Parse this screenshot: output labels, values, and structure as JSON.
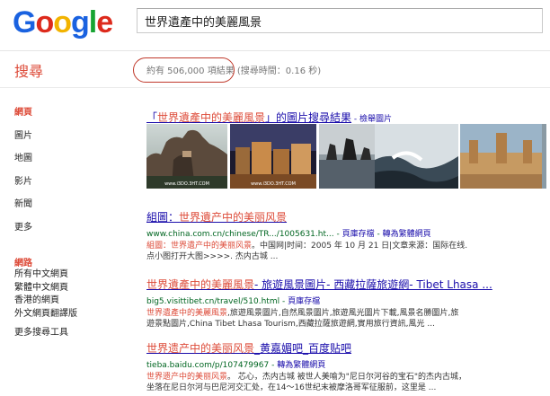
{
  "logo": {
    "text": "Google",
    "colors": [
      "#1a62e0",
      "#dd2a1c",
      "#f2b300",
      "#1a62e0",
      "#17a332",
      "#dd2a1c"
    ]
  },
  "search": {
    "query": "世界遺產中的美麗風景"
  },
  "header": {
    "section_title": "搜尋",
    "stats_main": "約有 506,000 項結果",
    "stats_time": " (搜尋時間：0.16 秒)"
  },
  "leftnav": {
    "items": [
      {
        "label": "網頁",
        "active": true
      },
      {
        "label": "圖片",
        "active": false
      },
      {
        "label": "地圖",
        "active": false
      },
      {
        "label": "影片",
        "active": false
      },
      {
        "label": "新聞",
        "active": false
      },
      {
        "label": "更多",
        "active": false
      }
    ],
    "sub_heading": "網路",
    "sub_items": [
      "所有中文網頁",
      "繁體中文網頁",
      "香港的網頁",
      "外文網頁翻譯版",
      "更多搜尋工具"
    ]
  },
  "image_result": {
    "title_prefix": "「",
    "title_query": "世界遺產中的美麗風景",
    "title_suffix": "」的圖片搜尋結果",
    "extra_link": " - 檢舉圖片"
  },
  "results": [
    {
      "title_parts": [
        [
          "",
          "組圖："
        ],
        [
          "hl",
          "世界遺产中的美丽风景"
        ]
      ],
      "url": "www.china.com.cn/chinese/TR.../1005631.ht...",
      "cache": "頁庫存檔",
      "convert": "轉為繁體網頁",
      "snippet_lines": [
        [
          [
            "hl",
            "組圖：世界遺产中的美丽风景"
          ],
          [
            "",
            "。中国网|时间：2005 年 10 月 21 日|文章来源：国际在线."
          ]
        ],
        [
          [
            "",
            "点小图打开大图>>>>. 杰内古城 ..."
          ]
        ]
      ]
    },
    {
      "title_parts": [
        [
          "hl",
          "世界遺產中的美麗風景"
        ],
        [
          "",
          "- 旅遊風景圖片- 西藏拉薩旅遊網- Tibet Lhasa ..."
        ]
      ],
      "url": "big5.visittibet.cn/travel/510.html",
      "cache": "頁庫存檔",
      "convert": "",
      "snippet_lines": [
        [
          [
            "hl",
            "世界遺產中的美麗風景"
          ],
          [
            "",
            ",旅遊風景圖片,自然風景圖片,旅遊風光圖片下載,風景名勝圖片,旅"
          ]
        ],
        [
          [
            "",
            "遊景點圖片,China Tibet Lhasa Tourism,西藏拉薩旅遊網,實用旅行資訊,風光 ..."
          ]
        ]
      ]
    },
    {
      "title_parts": [
        [
          "hl",
          "世界遗产中的美丽风景"
        ],
        [
          "",
          "_黄嘉媚吧_百度贴吧"
        ]
      ],
      "url": "tieba.baidu.com/p/107479967",
      "cache": "",
      "convert": "轉為繁體網頁",
      "snippet_lines": [
        [
          [
            "hl",
            "世界遗产中的美丽风景"
          ],
          [
            "",
            "。 芯心，杰内古城 被世人美喻为\"尼日尔河谷的宝石\"的杰内古城，"
          ]
        ],
        [
          [
            "",
            "坐落在尼日尔河与巴尼河交汇处，在14～16世纪末被摩洛哥军征服前，这里是 ..."
          ]
        ]
      ]
    }
  ],
  "thumbnails": [
    {
      "name": "meteora-rocks",
      "watermark": "www.i3DO.3HT.COM"
    },
    {
      "name": "night-city",
      "watermark": "www.i3DO.3HT.COM"
    },
    {
      "name": "sea-stacks",
      "watermark": ""
    },
    {
      "name": "ocean-waves",
      "watermark": ""
    },
    {
      "name": "djenne-mosque",
      "watermark": ""
    },
    {
      "name": "waterfall-cliff",
      "watermark": ""
    }
  ]
}
